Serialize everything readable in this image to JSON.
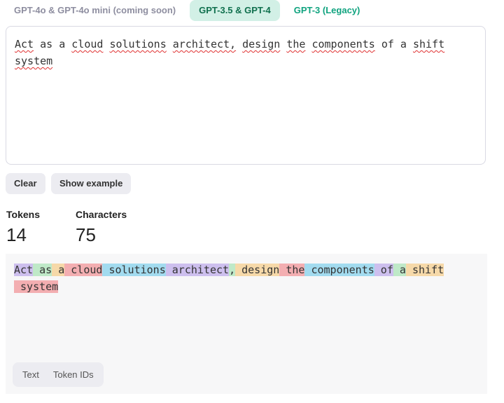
{
  "tabs": [
    {
      "label": "GPT-4o & GPT-4o mini (coming soon)"
    },
    {
      "label": "GPT-3.5 & GPT-4",
      "active": true
    },
    {
      "label": "GPT-3 (Legacy)"
    }
  ],
  "input": {
    "words": [
      "Act",
      "as",
      "a",
      "cloud",
      "solutions",
      "architect,",
      "design",
      "the",
      "components",
      "of",
      "a",
      "shift",
      "system"
    ]
  },
  "buttons": {
    "clear": "Clear",
    "example": "Show example"
  },
  "stats": {
    "tokens_label": "Tokens",
    "tokens": "14",
    "chars_label": "Characters",
    "chars": "75"
  },
  "colors": [
    "#cdbfee",
    "#bfe9c8",
    "#f6d9a9",
    "#f3aeb1",
    "#a2dbef"
  ],
  "tokens": [
    "Act",
    " as",
    " a",
    " cloud",
    " solutions",
    " architect",
    ",",
    " design",
    " the",
    " components",
    " of",
    " a",
    " shift",
    " system"
  ],
  "view_toggle": {
    "text": "Text",
    "ids": "Token IDs"
  }
}
